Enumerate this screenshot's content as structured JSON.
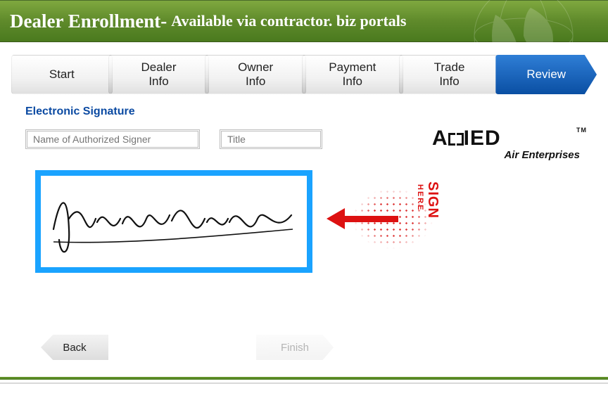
{
  "header": {
    "title": "Dealer Enrollment-",
    "subtitle": "Available via contractor. biz portals"
  },
  "steps": [
    {
      "label": "Start"
    },
    {
      "label": "Dealer\nInfo"
    },
    {
      "label": "Owner\nInfo"
    },
    {
      "label": "Payment\nInfo"
    },
    {
      "label": "Trade\nInfo"
    },
    {
      "label": "Review"
    }
  ],
  "section": {
    "title": "Electronic Signature",
    "name_field_placeholder": "Name of Authorized Signer",
    "title_field_placeholder": "Title"
  },
  "signature": {
    "sign_label": "SIGN",
    "here_label": "HERE"
  },
  "logo": {
    "brand": "ALLIED",
    "tagline": "Air Enterprises",
    "tm": "TM"
  },
  "nav": {
    "back_label": "Back",
    "finish_label": "Finish"
  },
  "colors": {
    "header_green": "#5f8a2b",
    "step_blue": "#0a4fa3",
    "link_blue": "#0b4aa2",
    "sign_box_blue": "#1aa3ff",
    "accent_red": "#d11"
  }
}
